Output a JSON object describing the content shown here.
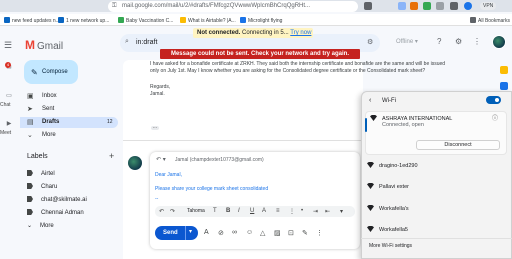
{
  "browser": {
    "url": "mail.google.com/mail/u/2/#drafts/FMfcgzQVwwwWplcmBhCrqQgRHt...",
    "vpn": "VPN",
    "bookmarks": [
      "new feed updates n...",
      "1 new network up...",
      "Baby Vaccination C...",
      "What is Airtable? |A...",
      "Microlight flying",
      "All Bookmarks"
    ]
  },
  "gmail": {
    "logo_text": "Gmail",
    "search_value": "in:draft",
    "status_offline": "Offline",
    "banner_notice": "Not connected.",
    "banner_notice_rest": "Connecting in 5...",
    "banner_try_now": "Try now",
    "banner_error": "Message could not be sent. Check your network and try again.",
    "compose_label": "Compose",
    "rail": {
      "mail_badge": "4",
      "chat_label": "Chat",
      "meet_label": "Meet"
    },
    "nav": [
      {
        "label": "Inbox",
        "count": "",
        "icon": "inbox-icon"
      },
      {
        "label": "Sent",
        "count": "",
        "icon": "send-icon"
      },
      {
        "label": "Drafts",
        "count": "12",
        "icon": "draft-icon",
        "active": true
      },
      {
        "label": "More",
        "count": "",
        "icon": "chevron-down-icon"
      }
    ],
    "labels_heading": "Labels",
    "labels": [
      "Airtel",
      "Charu",
      "chat@skilmate.ai",
      "Chennai Adman",
      "More"
    ]
  },
  "thread": {
    "lines": [
      "I have asked for a bonafide certificate at ZRKH. They said both the internship certificate and bonafide are the same and will be issued",
      "only on July 1st. May I know whether you are asking for the Consolidated degree certificate or the  Consolidated mark sheet?",
      "Regards,",
      "Jamal."
    ],
    "ellipsis": "..."
  },
  "reply": {
    "to": "Jamal (champdexter10773@gmail.com)",
    "body": [
      "Dear Jamal,",
      "Please share your college mark sheet consolidated",
      "--"
    ],
    "font": "Tahoma",
    "send_label": "Send"
  },
  "wifi": {
    "title": "Wi-Fi",
    "connected_name": "ASHRAYA INTERNATIONAL",
    "connected_status": "Connected, open",
    "disconnect_label": "Disconnect",
    "networks": [
      "dragino-1ed290",
      "Pallavi exter",
      "Workafella's",
      "Workafella5"
    ],
    "more_settings": "More Wi-Fi settings"
  },
  "colors": {
    "accent": "#0b57d0",
    "error": "#c5221f",
    "notice": "#fff4c2",
    "toggle": "#005fb8"
  }
}
